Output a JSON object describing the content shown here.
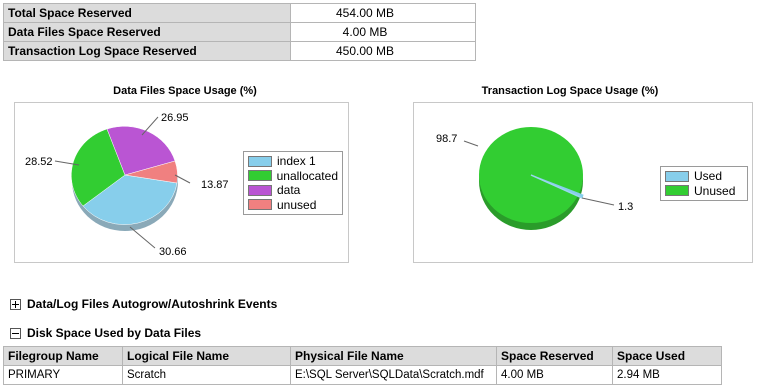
{
  "summary": [
    {
      "label": "Total Space Reserved",
      "value": "454.00 MB"
    },
    {
      "label": "Data Files Space Reserved",
      "value": "4.00 MB"
    },
    {
      "label": "Transaction Log Space Reserved",
      "value": "450.00 MB"
    }
  ],
  "charts": [
    {
      "title": "Data Files Space Usage (%)",
      "legend": [
        {
          "label": "index 1",
          "color": "#87ceeb"
        },
        {
          "label": "unallocated",
          "color": "#32cd32"
        },
        {
          "label": "data",
          "color": "#ba55d3"
        },
        {
          "label": "unused",
          "color": "#f08080"
        }
      ],
      "values_text": [
        "26.95",
        "28.52",
        "13.87",
        "30.66"
      ]
    },
    {
      "title": "Transaction Log Space Usage (%)",
      "legend": [
        {
          "label": "Used",
          "color": "#87ceeb"
        },
        {
          "label": "Unused",
          "color": "#32cd32"
        }
      ],
      "values_text": [
        "98.7",
        "1.3"
      ]
    }
  ],
  "chart_data": [
    {
      "type": "pie",
      "title": "Data Files Space Usage (%)",
      "categories": [
        "index 1",
        "unallocated",
        "data",
        "unused"
      ],
      "values": [
        30.66,
        28.52,
        26.95,
        13.87
      ],
      "legend": "right"
    },
    {
      "type": "pie",
      "title": "Transaction Log Space Usage (%)",
      "categories": [
        "Used",
        "Unused"
      ],
      "values": [
        1.3,
        98.7
      ],
      "legend": "right"
    }
  ],
  "sections": {
    "autogrow": "Data/Log Files Autogrow/Autoshrink Events",
    "disk_space": "Disk Space Used by Data Files"
  },
  "files_table": {
    "headers": [
      "Filegroup Name",
      "Logical File Name",
      "Physical File Name",
      "Space Reserved",
      "Space Used"
    ],
    "rows": [
      [
        "PRIMARY",
        "Scratch",
        "E:\\SQL Server\\SQLData\\Scratch.mdf",
        "4.00 MB",
        "2.94 MB"
      ]
    ]
  }
}
